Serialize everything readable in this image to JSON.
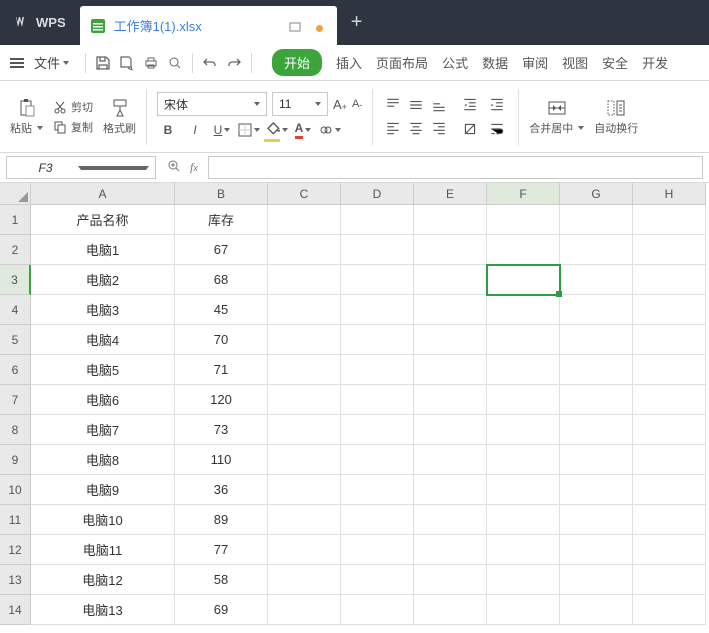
{
  "app": {
    "name": "WPS"
  },
  "tab": {
    "title": "工作簿1(1).xlsx"
  },
  "menu": {
    "file": "文件",
    "tabs": {
      "start": "开始",
      "insert": "插入",
      "layout": "页面布局",
      "formula": "公式",
      "data": "数据",
      "review": "审阅",
      "view": "视图",
      "security": "安全",
      "dev": "开发"
    }
  },
  "ribbon": {
    "paste": "粘贴",
    "cut": "剪切",
    "copy": "复制",
    "painter": "格式刷",
    "font": "宋体",
    "size": "11",
    "merge": "合并居中",
    "wrap": "自动换行"
  },
  "formula": {
    "namebox": "F3"
  },
  "columns": [
    "A",
    "B",
    "C",
    "D",
    "E",
    "F",
    "G",
    "H"
  ],
  "chart_data": {
    "type": "table",
    "headers": [
      "产品名称",
      "库存"
    ],
    "rows": [
      [
        "电脑1",
        67
      ],
      [
        "电脑2",
        68
      ],
      [
        "电脑3",
        45
      ],
      [
        "电脑4",
        70
      ],
      [
        "电脑5",
        71
      ],
      [
        "电脑6",
        120
      ],
      [
        "电脑7",
        73
      ],
      [
        "电脑8",
        110
      ],
      [
        "电脑9",
        36
      ],
      [
        "电脑10",
        89
      ],
      [
        "电脑11",
        77
      ],
      [
        "电脑12",
        58
      ],
      [
        "电脑13",
        69
      ]
    ]
  },
  "active_cell": "F3"
}
